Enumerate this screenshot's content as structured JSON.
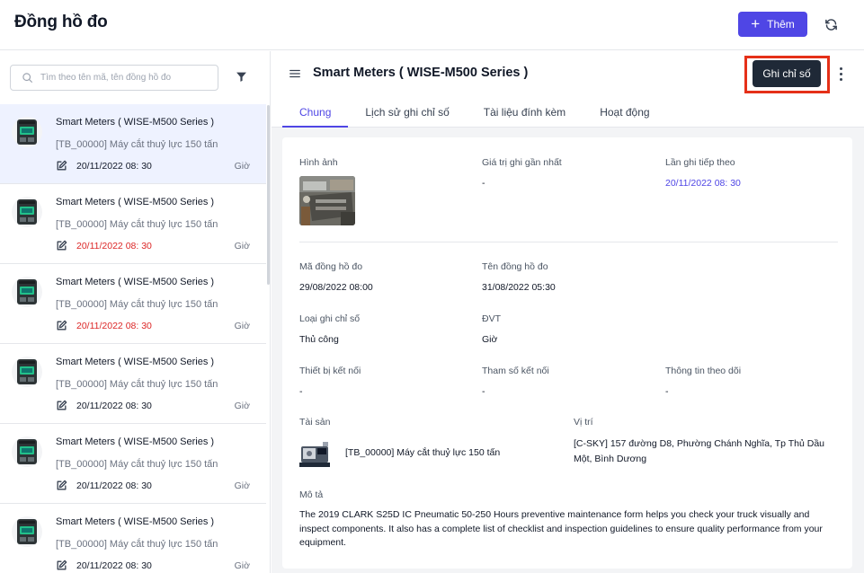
{
  "header": {
    "title": "Đồng hồ đo",
    "add_label": "Thêm"
  },
  "colors": {
    "accent": "#4f46e5",
    "dark_button": "#1f2937",
    "overdue": "#dc2626",
    "highlight_box": "#e53018"
  },
  "search": {
    "placeholder": "Tìm theo tên mã, tên đồng hồ đo"
  },
  "list": {
    "items": [
      {
        "name": "Smart Meters ( WISE-M500 Series )",
        "asset": "[TB_00000] Máy cắt thuỷ lực 150 tấn",
        "date": "20/11/2022 08: 30",
        "unit": "Giờ",
        "overdue": false,
        "active": true
      },
      {
        "name": "Smart Meters ( WISE-M500 Series )",
        "asset": "[TB_00000] Máy cắt thuỷ lực 150 tấn",
        "date": "20/11/2022 08: 30",
        "unit": "Giờ",
        "overdue": true,
        "active": false
      },
      {
        "name": "Smart Meters ( WISE-M500 Series )",
        "asset": "[TB_00000] Máy cắt thuỷ lực 150 tấn",
        "date": "20/11/2022 08: 30",
        "unit": "Giờ",
        "overdue": true,
        "active": false
      },
      {
        "name": "Smart Meters ( WISE-M500 Series )",
        "asset": "[TB_00000] Máy cắt thuỷ lực 150 tấn",
        "date": "20/11/2022 08: 30",
        "unit": "Giờ",
        "overdue": false,
        "active": false
      },
      {
        "name": "Smart Meters ( WISE-M500 Series )",
        "asset": "[TB_00000] Máy cắt thuỷ lực 150 tấn",
        "date": "20/11/2022 08: 30",
        "unit": "Giờ",
        "overdue": false,
        "active": false
      },
      {
        "name": "Smart Meters ( WISE-M500 Series )",
        "asset": "[TB_00000] Máy cắt thuỷ lực 150 tấn",
        "date": "20/11/2022 08: 30",
        "unit": "Giờ",
        "overdue": false,
        "active": false
      }
    ]
  },
  "detail": {
    "title": "Smart Meters ( WISE-M500 Series )",
    "record_label": "Ghi chỉ số",
    "tabs": [
      {
        "label": "Chung",
        "active": true
      },
      {
        "label": "Lịch sử ghi chỉ số",
        "active": false
      },
      {
        "label": "Tài liệu đính kèm",
        "active": false
      },
      {
        "label": "Hoạt động",
        "active": false
      }
    ],
    "fields": {
      "image_label": "Hình ảnh",
      "latest_value_label": "Giá trị ghi gần nhất",
      "latest_value": "-",
      "next_record_label": "Lần ghi tiếp theo",
      "next_record": "20/11/2022 08: 30",
      "code_label": "Mã đồng hồ đo",
      "code": "29/08/2022 08:00",
      "name_label": "Tên đồng hồ đo",
      "name": "31/08/2022 05:30",
      "record_type_label": "Loại ghi chỉ số",
      "record_type": "Thủ công",
      "unit_label": "ĐVT",
      "unit": "Giờ",
      "device_label": "Thiết bị kết nối",
      "device": "-",
      "param_label": "Tham số kết nối",
      "param": "-",
      "tracking_label": "Thông tin theo dõi",
      "tracking": "-",
      "asset_label": "Tài sản",
      "asset": "[TB_00000] Máy cắt thuỷ lực 150 tấn",
      "location_label": "Vị trí",
      "location": "[C-SKY] 157 đường D8, Phường Chánh Nghĩa, Tp Thủ Dầu Một, Bình Dương",
      "description_label": "Mô tả",
      "description": "The 2019 CLARK S25D IC Pneumatic 50-250 Hours preventive maintenance form helps you check your truck visually and inspect components. It also has a complete list of checklist and inspection guidelines to ensure quality performance from your equipment."
    }
  }
}
